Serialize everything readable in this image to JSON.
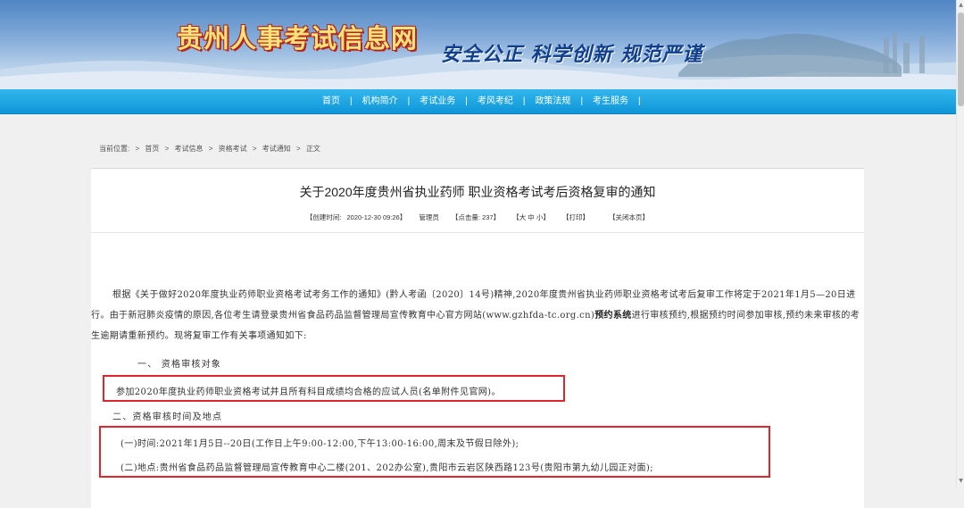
{
  "header": {
    "site_title": "贵州人事考试信息网",
    "slogan": "安全公正 科学创新 规范严谨"
  },
  "nav": {
    "items": [
      "首页",
      "机构简介",
      "考试业务",
      "考风考纪",
      "政策法规",
      "考生服务"
    ],
    "separator": "|"
  },
  "breadcrumb": {
    "prefix": "当前位置:",
    "separator": ">",
    "items": [
      "首页",
      "考试信息",
      "资格考试",
      "考试通知",
      "正文"
    ]
  },
  "article": {
    "title": "关于2020年度贵州省执业药师 职业资格考试考后资格复审的通知",
    "meta": {
      "created_label": "【创建时间:",
      "created_value": "2020-12-30 09:26】",
      "author": "管理员",
      "views": "【点击量: 237】",
      "font_size": "【大 中 小】",
      "print": "【打印】",
      "close": "【关闭本页】"
    },
    "intro_part1": "根据《关于做好2020年度执业药师职业资格考试考务工作的通知》(黔人考函〔2020〕14号)精神,2020年度贵州省执业药师职业资格考试考后复审工作将定于2021年1月5—20日进行。由于新冠肺炎疫情的原因,各位考生请登录贵州省食品药品监督管理局宣传教育中心官方网站(www.gzhfda-tc.org.cn)",
    "intro_bold": "预约系统",
    "intro_part2": "进行审核预约,根据预约时间参加审核,预约未来审核的考生逾期请重新预约。现将复审工作有关事项通知如下:",
    "section1_heading": "一、 资格审核对象",
    "section1_text": "参加2020年度执业药师职业资格考试并且所有科目成绩均合格的应试人员(名单附件见官网)。",
    "section2_heading": "二、资格审核时间及地点",
    "section2_time": "(一)时间:2021年1月5日--20日(工作日上午9:00-12:00,下午13:00-16:00,周末及节假日除外);",
    "section2_place": "(二)地点:贵州省食品药品监督管理局宣传教育中心二楼(201、202办公室),贵阳市云岩区陕西路123号(贵阳市第九幼儿园正对面);"
  },
  "colors": {
    "nav_bg": "#1aa3e0",
    "highlight_box": "#e0262d",
    "title_text": "#ffe27a",
    "slogan_text": "#0f3f8c"
  }
}
